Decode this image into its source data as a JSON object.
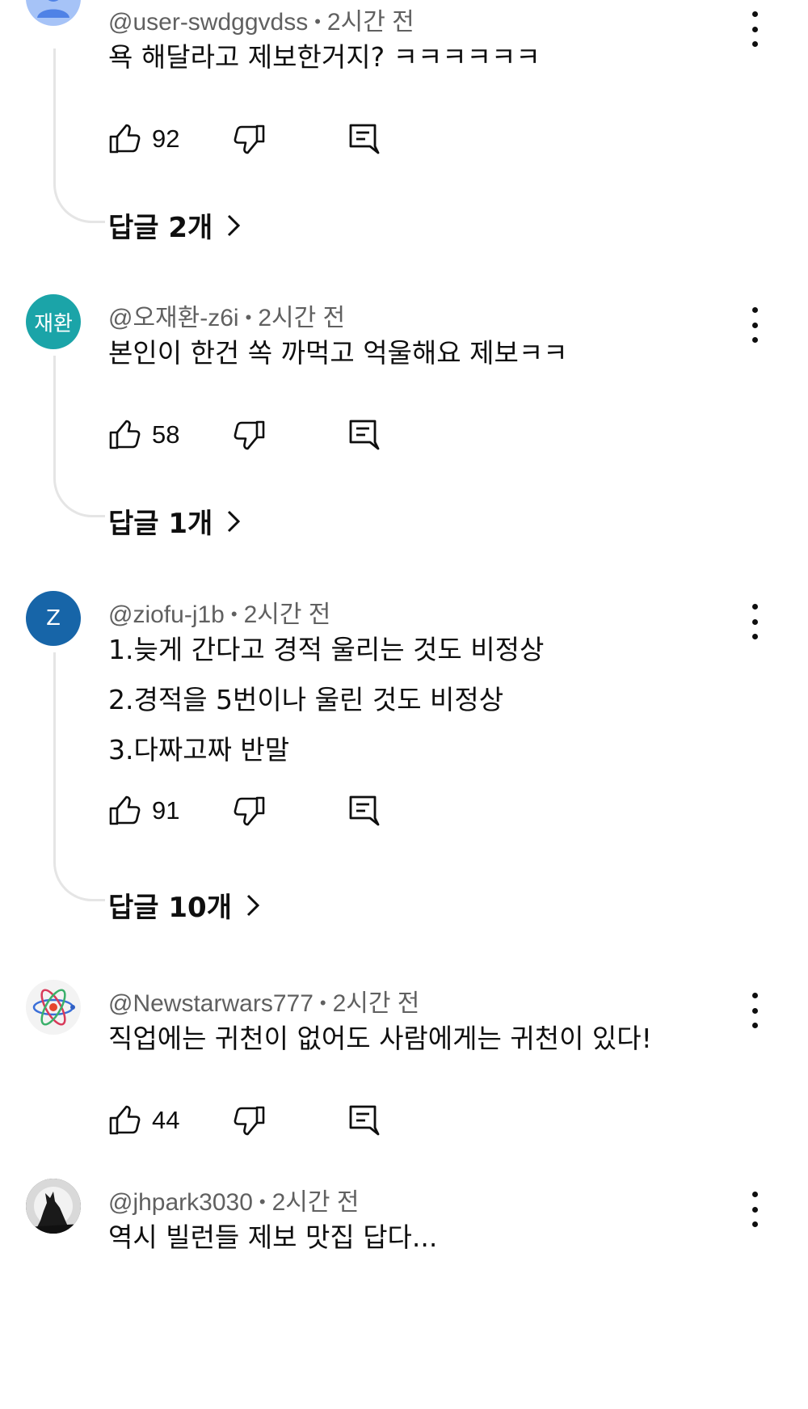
{
  "comments": [
    {
      "handle": "@user-swdggvdss",
      "time": "2시간 전",
      "avatar": {
        "type": "person-icon",
        "bg": "#a6c3f7"
      },
      "lines": [
        "욕 해달라고 제보한거지? ㅋㅋㅋㅋㅋㅋ"
      ],
      "likes": "92",
      "replies": "답글 2개"
    },
    {
      "handle": "@오재환-z6i",
      "time": "2시간 전",
      "avatar": {
        "type": "text",
        "text": "재환",
        "bg": "#1ba4a8"
      },
      "lines": [
        "본인이 한건 쏙 까먹고 억울해요 제보ㅋㅋ"
      ],
      "likes": "58",
      "replies": "답글 1개"
    },
    {
      "handle": "@ziofu-j1b",
      "time": "2시간 전",
      "avatar": {
        "type": "text",
        "text": "Z",
        "bg": "#1765a8"
      },
      "lines": [
        "1.늦게 간다고 경적 울리는 것도 비정상",
        "2.경적을 5번이나 울린 것도 비정상",
        "3.다짜고짜 반말"
      ],
      "likes": "91",
      "replies": "답글 10개"
    },
    {
      "handle": "@Newstarwars777",
      "time": "2시간 전",
      "avatar": {
        "type": "atom-icon",
        "bg": "#f3f3f3"
      },
      "lines": [
        "직업에는 귀천이 없어도 사람에게는 귀천이 있다!"
      ],
      "likes": "44"
    },
    {
      "handle": "@jhpark3030",
      "time": "2시간 전",
      "avatar": {
        "type": "wolf-icon",
        "bg": "#2a2a2a"
      },
      "lines": [
        "역시 빌런들 제보 맛집 답다..."
      ]
    }
  ],
  "separator": "•"
}
